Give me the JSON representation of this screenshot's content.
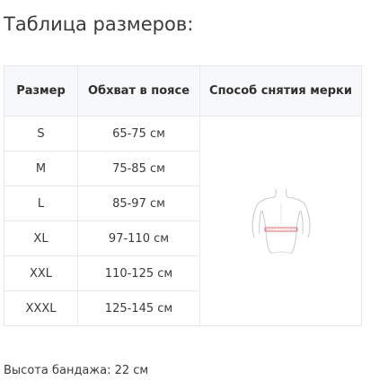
{
  "page": {
    "title": "Таблица размеров:"
  },
  "table": {
    "headers": {
      "size": "Размер",
      "waist": "Обхват в поясе",
      "method": "Способ снятия мерки"
    },
    "rows": [
      {
        "size": "S",
        "waist": "65-75 см"
      },
      {
        "size": "M",
        "waist": "75-85 см"
      },
      {
        "size": "L",
        "waist": "85-97 см"
      },
      {
        "size": "XL",
        "waist": "97-110 см"
      },
      {
        "size": "XXL",
        "waist": "110-125 см"
      },
      {
        "size": "XXXL",
        "waist": "125-145 см"
      }
    ],
    "measure_image": "torso-waist-measurement-figure",
    "colors": {
      "border": "#e6e8eb",
      "header_bg": "#f7f8fa",
      "measure_line": "#e26a6a"
    }
  },
  "footer": {
    "note": "Высота бандажа: 22 см"
  }
}
